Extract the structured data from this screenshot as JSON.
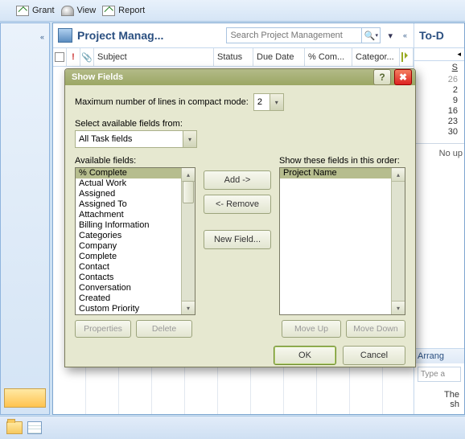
{
  "toolbar": {
    "grant": "Grant",
    "view": "View",
    "report": "Report"
  },
  "panel": {
    "title": "Project Manag...",
    "search_placeholder": "Search Project Management",
    "columns": {
      "subject": "Subject",
      "status": "Status",
      "due": "Due Date",
      "complete": "% Com...",
      "categ": "Categor..."
    }
  },
  "todo": {
    "title": "To-D",
    "cal_hdr": "S",
    "days": [
      "26",
      "2",
      "9",
      "16",
      "23",
      "30"
    ],
    "noup": "No up",
    "arrange": "Arrang",
    "type": "Type a",
    "msg1": "The",
    "msg2": "sh"
  },
  "dialog": {
    "title": "Show Fields",
    "maxlines_label": "Maximum number of lines in compact mode:",
    "maxlines_value": "2",
    "select_from_label": "Select available fields from:",
    "select_from_value": "All Task fields",
    "avail_label": "Available fields:",
    "show_label": "Show these fields in this order:",
    "available": [
      "% Complete",
      "Actual Work",
      "Assigned",
      "Assigned To",
      "Attachment",
      "Billing Information",
      "Categories",
      "Company",
      "Complete",
      "Contact",
      "Contacts",
      "Conversation",
      "Created",
      "Custom Priority"
    ],
    "shown": [
      "Project Name"
    ],
    "add": "Add ->",
    "remove": "<- Remove",
    "newfield": "New Field...",
    "properties": "Properties",
    "delete": "Delete",
    "moveup": "Move Up",
    "movedown": "Move Down",
    "ok": "OK",
    "cancel": "Cancel"
  }
}
